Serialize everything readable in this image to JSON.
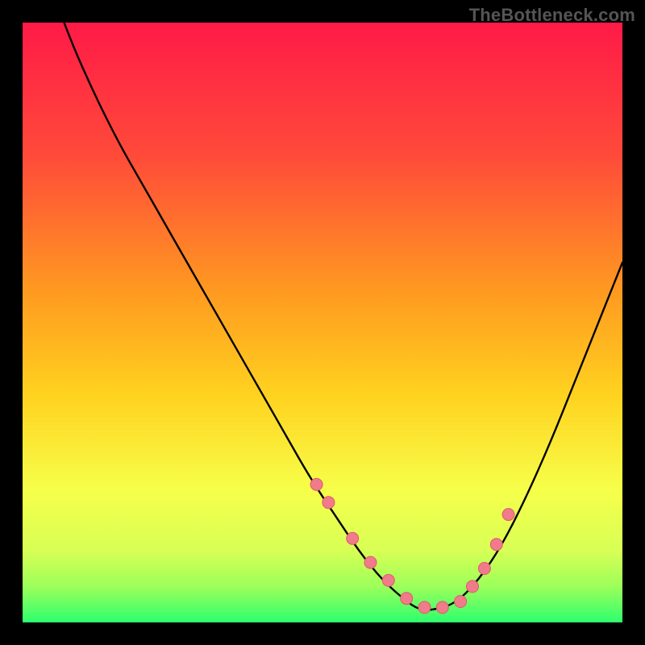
{
  "watermark": "TheBottleneck.com",
  "colors": {
    "bg_black": "#000000",
    "grad_top": "#ff1a47",
    "grad_mid1": "#ff6a2a",
    "grad_mid2": "#ffd21f",
    "grad_mid3": "#f6ff4a",
    "grad_bottom": "#2dff6e",
    "curve": "#000000",
    "dot_fill": "#f07b8a",
    "dot_stroke": "#e05a6c"
  },
  "chart_data": {
    "type": "line",
    "title": "",
    "xlabel": "",
    "ylabel": "",
    "x_range": [
      0,
      100
    ],
    "y_range": [
      0,
      100
    ],
    "series": [
      {
        "name": "bottleneck-curve",
        "x": [
          0,
          4,
          8,
          12,
          16,
          20,
          24,
          28,
          32,
          36,
          40,
          44,
          48,
          52,
          56,
          60,
          64,
          66,
          68,
          72,
          76,
          80,
          84,
          88,
          92,
          96,
          100
        ],
        "y": [
          120,
          108,
          97,
          88,
          80,
          73,
          66,
          59,
          52,
          45,
          38,
          31,
          24,
          18,
          12,
          7,
          3.5,
          2.2,
          2,
          3,
          7,
          13,
          21,
          30,
          40,
          50,
          60
        ]
      }
    ],
    "scatter_points": {
      "name": "highlighted-dots",
      "x": [
        49,
        51,
        55,
        58,
        61,
        64,
        67,
        70,
        73,
        75,
        77,
        79,
        81
      ],
      "y": [
        23,
        20,
        14,
        10,
        7,
        4,
        2.5,
        2.5,
        3.5,
        6,
        9,
        13,
        18
      ]
    }
  }
}
